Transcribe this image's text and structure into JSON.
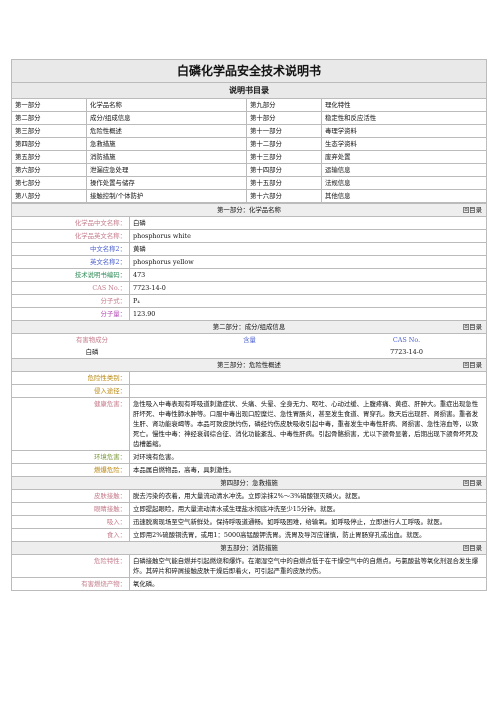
{
  "title": "白磷化学品安全技术说明书",
  "toc": {
    "heading": "说明书目录",
    "rows": [
      [
        "第一部分",
        "化学品名称",
        "第九部分",
        "理化特性"
      ],
      [
        "第二部分",
        "成分/组成信息",
        "第十部分",
        "稳定性和反应活性"
      ],
      [
        "第三部分",
        "危险性概述",
        "第十一部分",
        "毒理学资料"
      ],
      [
        "第四部分",
        "急救措施",
        "第十二部分",
        "生态学资料"
      ],
      [
        "第五部分",
        "消防措施",
        "第十三部分",
        "废弃处置"
      ],
      [
        "第六部分",
        "泄漏应急处理",
        "第十四部分",
        "运输信息"
      ],
      [
        "第七部分",
        "操作处置与储存",
        "第十五部分",
        "法规信息"
      ],
      [
        "第八部分",
        "接触控制/个体防护",
        "第十六部分",
        "其他信息"
      ]
    ]
  },
  "back_label": "回目录",
  "part1": {
    "title": "第一部分：化学品名称",
    "rows": [
      {
        "label": "化学品中文名称：",
        "value": "白磷"
      },
      {
        "label": "化学品英文名称：",
        "value": "phosphorus white"
      },
      {
        "label": "中文名称2：",
        "value": "黄磷"
      },
      {
        "label": "英文名称2：",
        "value": "phosphorus yellow"
      },
      {
        "label": "技术说明书编码：",
        "value": "473"
      },
      {
        "label": "CAS No.：",
        "value": "7723-14-0"
      },
      {
        "label": "分子式：",
        "value": "P₄"
      },
      {
        "label": "分子量：",
        "value": "123.90"
      }
    ]
  },
  "part2": {
    "title": "第二部分：成分/组成信息",
    "header_hazard": "有害物成分",
    "header_content": "含量",
    "header_cas": "CAS No.",
    "item_name": "白磷",
    "item_cas": "7723-14-0"
  },
  "part3": {
    "title": "第三部分：危险性概述",
    "rows": [
      {
        "label": "危险性类别：",
        "value": ""
      },
      {
        "label": "侵入途径：",
        "value": ""
      },
      {
        "label": "健康危害：",
        "value": "急性吸入中毒表现有呼吸道刺激症状、头痛、头晕、全身无力、呕吐、心动过缓、上腹疼痛、黄疸、肝肿大。重症出现急性肝坏死、中毒性肺水肿等。口服中毒出现口腔糜烂、急性胃肠炎，甚至发生食道、胃穿孔。数天后出现肝、肾损害。重者发生肝、肾功能衰竭等。本品可致皮肤灼伤，磷经灼伤皮肤吸收引起中毒，重者发生中毒性肝病、肾损害、急性溶血等，以致死亡。慢性中毒：神经衰弱综合征、消化功能紊乱、中毒性肝病。引起骨骼损害，尤以下颌骨显著，后期出现下颌骨坏死及齿槽萎缩。"
      },
      {
        "label": "环境危害：",
        "value": "对环境有危害。"
      },
      {
        "label": "燃爆危险：",
        "value": "本品属自燃物品，高毒，具刺激性。"
      }
    ]
  },
  "part4": {
    "title": "第四部分：急救措施",
    "rows": [
      {
        "label": "皮肤接触：",
        "value": "脱去污染的衣着，用大量流动清水冲洗。立即涂抹2%～3%硝酸银灭磷火。就医。"
      },
      {
        "label": "眼睛接触：",
        "value": "立即提起眼睑，用大量流动清水或生理盐水彻底冲洗至少15分钟。就医。"
      },
      {
        "label": "吸入：",
        "value": "迅速脱离现场至空气新鲜处。保持呼吸道通畅。如呼吸困难，给输氧。如呼吸停止，立即进行人工呼吸。就医。"
      },
      {
        "label": "食入：",
        "value": "立即用2%硫酸铜洗胃，或用1：5000高锰酸钾洗胃。洗胃及导泻应谨慎，防止胃肠穿孔或出血。就医。"
      }
    ]
  },
  "part5": {
    "title": "第五部分：消防措施",
    "rows": [
      {
        "label": "危险特性：",
        "value": "白磷接触空气能自燃并引起燃烧和爆炸。在潮湿空气中的自燃点低于在干燥空气中的自燃点。与氯酸盐等氧化剂混合发生爆炸。其碎片和碎屑接触皮肤干燥后即着火，可引起严重的皮肤灼伤。"
      },
      {
        "label": "有害燃烧产物：",
        "value": "氧化磷。"
      }
    ]
  }
}
